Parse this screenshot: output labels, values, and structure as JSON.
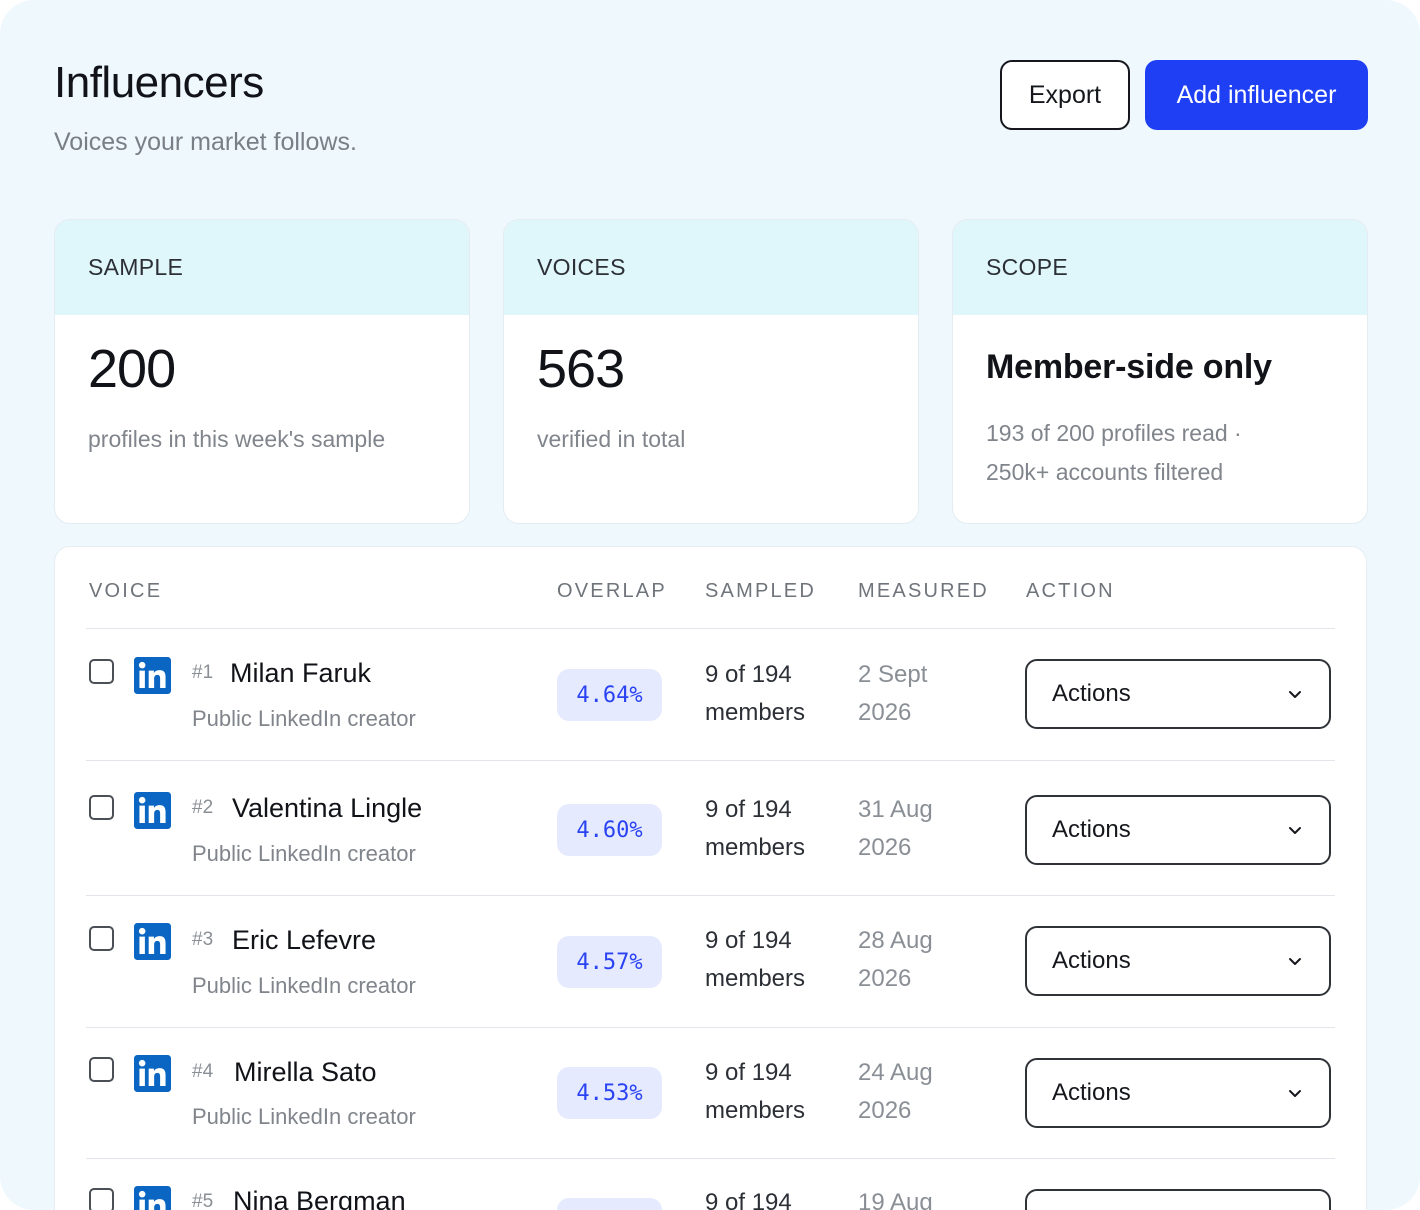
{
  "header": {
    "title": "Influencers",
    "subtitle": "Voices your market follows.",
    "export_label": "Export",
    "add_label": "Add influencer"
  },
  "stats": [
    {
      "label": "SAMPLE",
      "value": "200",
      "desc": "profiles in this week's sample"
    },
    {
      "label": "VOICES",
      "value": "563",
      "desc": "verified in total"
    },
    {
      "label": "SCOPE",
      "value": "Member-side only",
      "desc_line1": "193 of 200 profiles read ·",
      "desc_line2": "250k+ accounts filtered"
    }
  ],
  "table": {
    "columns": {
      "voice": "VOICE",
      "overlap": "OVERLAP",
      "sampled": "SAMPLED",
      "measured": "MEASURED",
      "action": "ACTION"
    },
    "rows": [
      {
        "rank": "#1",
        "name": "Milan Faruk",
        "role": "Public LinkedIn creator",
        "overlap": "4.64%",
        "sampled_1": "9 of 194",
        "sampled_2": "members",
        "measured_1": "2 Sept",
        "measured_2": "2026",
        "action": "Actions"
      },
      {
        "rank": "#2",
        "name": "Valentina Lingle",
        "role": "Public LinkedIn creator",
        "overlap": "4.60%",
        "sampled_1": "9 of 194",
        "sampled_2": "members",
        "measured_1": "31 Aug",
        "measured_2": "2026",
        "action": "Actions"
      },
      {
        "rank": "#3",
        "name": "Eric Lefevre",
        "role": "Public LinkedIn creator",
        "overlap": "4.57%",
        "sampled_1": "9 of 194",
        "sampled_2": "members",
        "measured_1": "28 Aug",
        "measured_2": "2026",
        "action": "Actions"
      },
      {
        "rank": "#4",
        "name": "Mirella Sato",
        "role": "Public LinkedIn creator",
        "overlap": "4.53%",
        "sampled_1": "9 of 194",
        "sampled_2": "members",
        "measured_1": "24 Aug",
        "measured_2": "2026",
        "action": "Actions"
      },
      {
        "rank": "#5",
        "name": "Nina Bergman",
        "sampled_1": "9 of 194",
        "measured_1": "19 Aug"
      }
    ]
  },
  "icons": {
    "row_icon": "linkedin-icon",
    "select_icon": "chevron-down-icon"
  },
  "colors": {
    "accent": "#1f3ff5",
    "linkedin": "#0a66c2",
    "pill_bg": "#e6eafe",
    "pill_text": "#2a43f2",
    "card_head": "#dff6fb",
    "page_bg": "#eef8fd"
  }
}
